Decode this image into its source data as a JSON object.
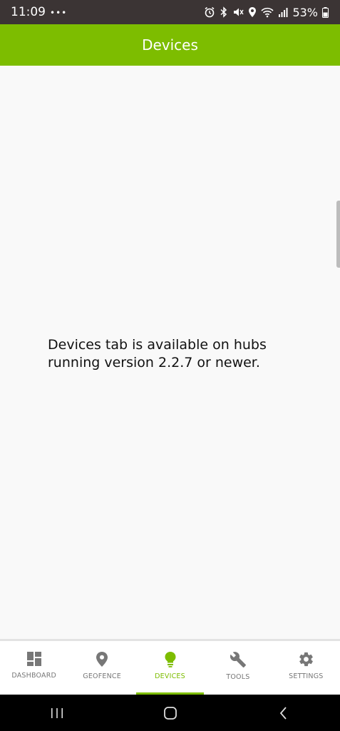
{
  "status_bar": {
    "time": "11:09",
    "notification_dots": "•••",
    "battery": "53%"
  },
  "app_bar": {
    "title": "Devices"
  },
  "content": {
    "message": "Devices tab is available on hubs running version 2.2.7 or newer."
  },
  "bottom_nav": {
    "items": [
      {
        "label": "DASHBOARD",
        "icon": "dashboard-icon",
        "active": false
      },
      {
        "label": "GEOFENCE",
        "icon": "location-pin-icon",
        "active": false
      },
      {
        "label": "DEVICES",
        "icon": "lightbulb-icon",
        "active": true
      },
      {
        "label": "TOOLS",
        "icon": "wrench-icon",
        "active": false
      },
      {
        "label": "SETTINGS",
        "icon": "gear-icon",
        "active": false
      }
    ]
  },
  "colors": {
    "accent": "#7dbd00",
    "status_bar": "#3b3434",
    "inactive": "#777777"
  }
}
